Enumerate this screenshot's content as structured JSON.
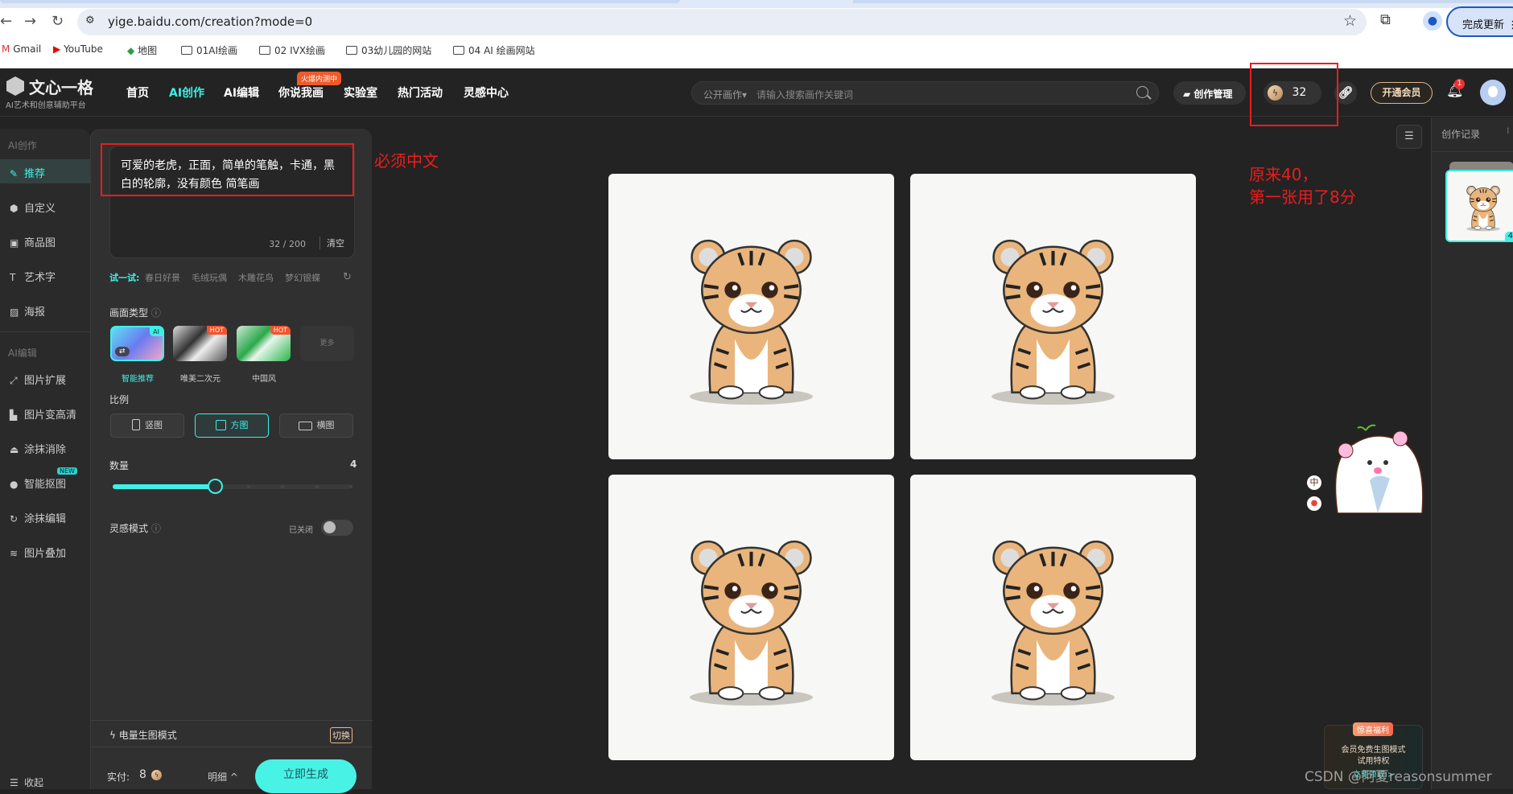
{
  "browser": {
    "url": "yige.baidu.com/creation?mode=0",
    "update_button": "完成更新",
    "bookmarks": [
      "Gmail",
      "YouTube",
      "地图",
      "01AI绘画",
      "02 IVX绘画",
      "03幼儿园的网站",
      "04 AI 绘画网站"
    ]
  },
  "header": {
    "logo_title": "文心一格",
    "logo_subtitle": "AI艺术和创意辅助平台",
    "nav": [
      "首页",
      "AI创作",
      "AI编辑",
      "你说我画",
      "实验室",
      "热门活动",
      "灵感中心"
    ],
    "active_nav": "AI创作",
    "hot_badge": "火爆内测中",
    "search_scope": "公开画作▾",
    "search_placeholder": "请输入搜索画作关键词",
    "manage_label": "创作管理",
    "credits": "32",
    "vip_label": "开通会员",
    "notification_count": "1"
  },
  "sidebar": {
    "section_create": "AI创作",
    "create_items": [
      {
        "label": "推荐",
        "icon": "brush-icon",
        "glyph": "✎"
      },
      {
        "label": "自定义",
        "icon": "cube-icon",
        "glyph": "⬢"
      },
      {
        "label": "商品图",
        "icon": "bag-icon",
        "glyph": "▣"
      },
      {
        "label": "艺术字",
        "icon": "text-icon",
        "glyph": "T"
      },
      {
        "label": "海报",
        "icon": "image-icon",
        "glyph": "▨"
      }
    ],
    "section_edit": "AI编辑",
    "edit_items": [
      {
        "label": "图片扩展",
        "icon": "expand-icon",
        "glyph": "⤢"
      },
      {
        "label": "图片变高清",
        "icon": "hd-icon",
        "glyph": "▙"
      },
      {
        "label": "涂抹消除",
        "icon": "eraser-icon",
        "glyph": "⏏"
      },
      {
        "label": "智能抠图",
        "icon": "cutout-icon",
        "glyph": "●",
        "badge": "NEW"
      },
      {
        "label": "涂抹编辑",
        "icon": "smear-icon",
        "glyph": "↻"
      },
      {
        "label": "图片叠加",
        "icon": "layers-icon",
        "glyph": "≋"
      }
    ],
    "collapse_label": "收起"
  },
  "panel": {
    "prompt": "可爱的老虎，正面，简单的笔触，卡通，黑白的轮廓，没有颜色 简笔画",
    "char_count": "32 / 200",
    "clear_label": "清空",
    "try_label": "试一试:",
    "try_items": [
      "春日好景",
      "毛绒玩偶",
      "木雕花鸟",
      "梦幻银蝶"
    ],
    "style_label": "画面类型",
    "styles": [
      {
        "label": "智能推荐",
        "badge": "AI",
        "selected": true
      },
      {
        "label": "唯美二次元",
        "badge": "HOT"
      },
      {
        "label": "中国风",
        "badge": "HOT"
      }
    ],
    "more_label": "更多",
    "ratio_label": "比例",
    "ratios": [
      {
        "label": "竖图",
        "selected": false
      },
      {
        "label": "方图",
        "selected": true
      },
      {
        "label": "横图",
        "selected": false
      }
    ],
    "quantity_label": "数量",
    "quantity": "4",
    "quantity_min": 1,
    "quantity_max": 8,
    "inspiration_label": "灵感模式",
    "inspiration_state": "已关闭",
    "power_mode_label": "电量生图模式",
    "switch_label": "切换",
    "pay_label": "实付:",
    "pay_amount": "8",
    "detail_label": "明细 ^",
    "generate_label": "立即生成"
  },
  "annotations": {
    "prompt_note": "必须中文",
    "credit_note_line1": "原来40，",
    "credit_note_line2": "第一张用了8分",
    "color": "#ee1c1c"
  },
  "history": {
    "title": "创作记录",
    "count": "4"
  },
  "promo": {
    "tag": "惊喜福利",
    "line1": "会员免费生图模式",
    "line2": "试用特权",
    "cta": "立刻领取 >"
  },
  "ime": {
    "lang": "中"
  },
  "watermark": "CSDN @阿夏reasonsummer",
  "colors": {
    "accent": "#3ef0e6",
    "background": "#232323",
    "panel": "#303030"
  }
}
